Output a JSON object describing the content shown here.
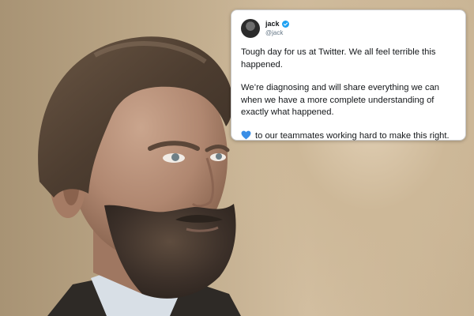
{
  "tweet": {
    "display_name": "jack",
    "handle": "@jack",
    "paragraphs": [
      "Tough day for us at Twitter. We all feel terrible this happened.",
      "We’re diagnosing and will share everything we can when we have a more complete understanding of exactly what happened."
    ],
    "closing_text": "to our teammates working hard to make this right.",
    "closing_icon": "blue-heart-icon",
    "verified_icon": "verified-badge-icon"
  },
  "colors": {
    "background_beige": "#d2bea0",
    "verified_blue": "#1da1f2",
    "heart_blue": "#3a8ee6",
    "text": "#14171a",
    "handle_gray": "#657786"
  }
}
